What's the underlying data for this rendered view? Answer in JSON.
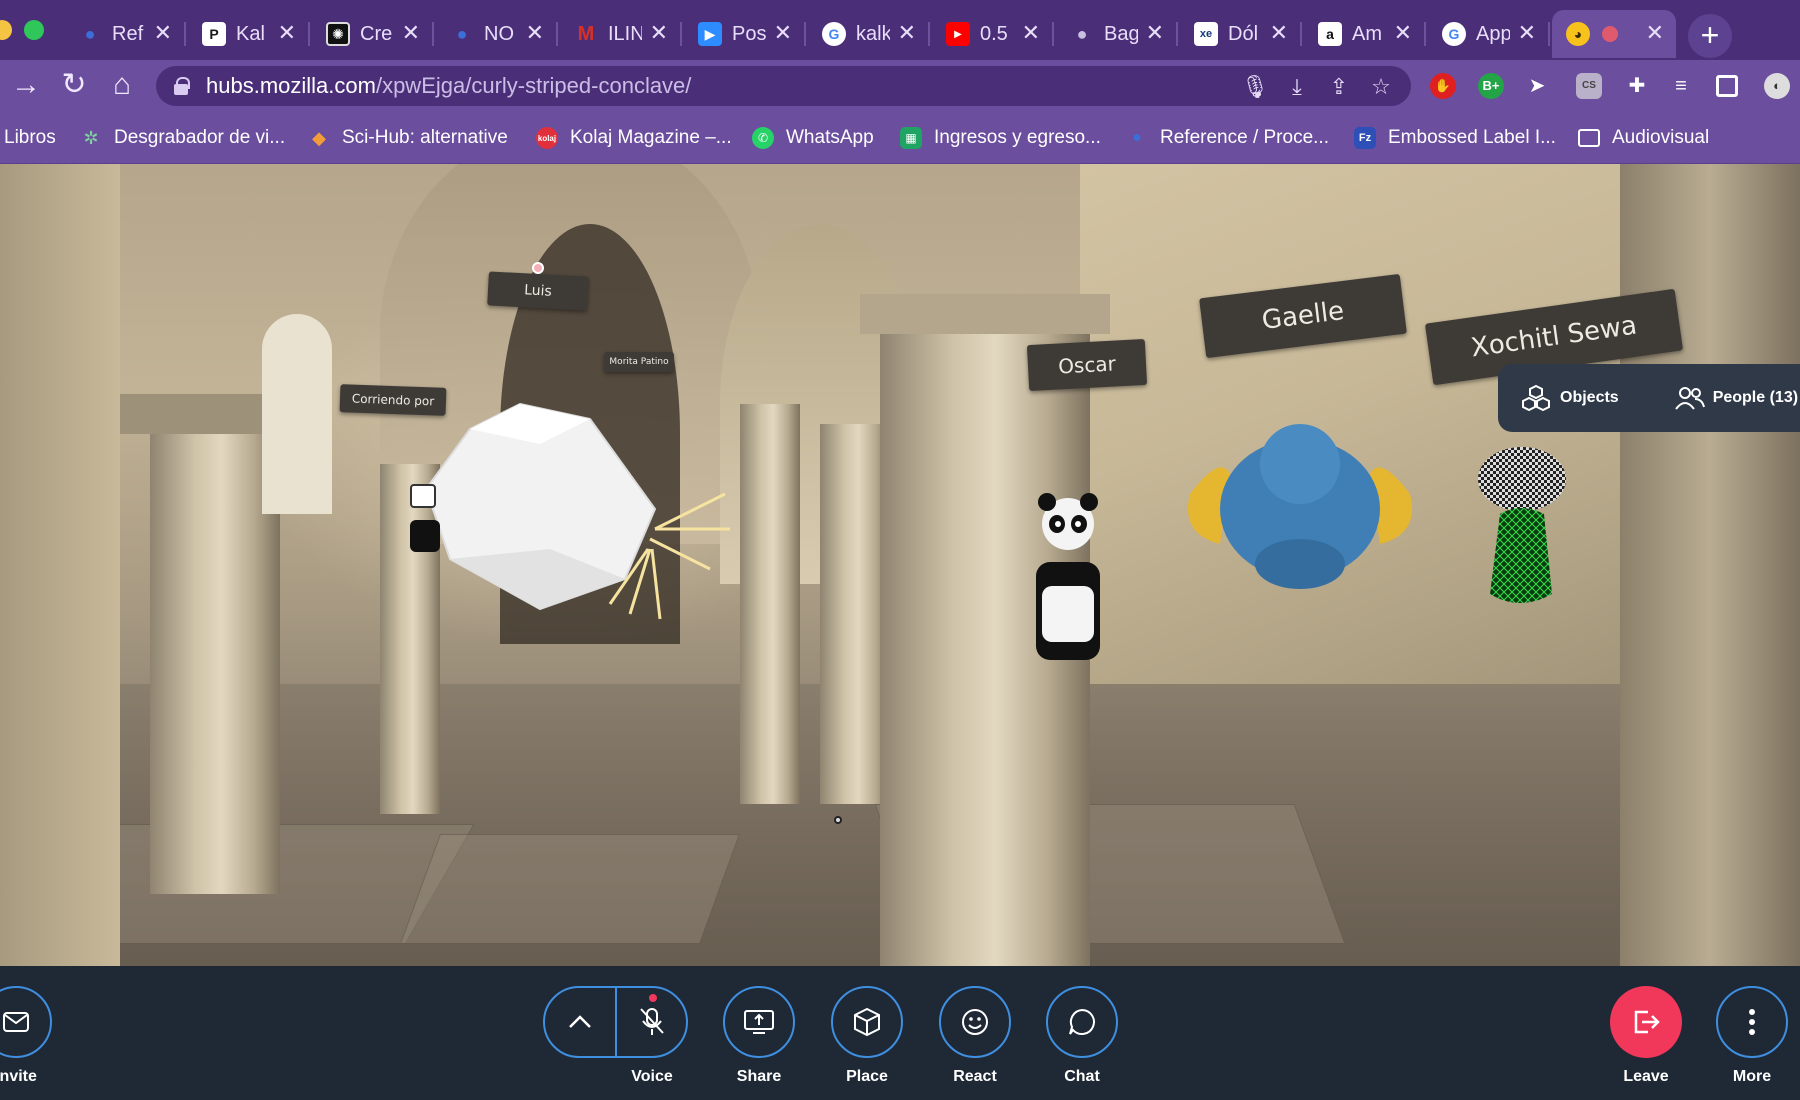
{
  "browser": {
    "tabs": [
      {
        "title": "Ref",
        "favicon": "blue-dots-icon",
        "color": "#3b6fd8"
      },
      {
        "title": "Kal",
        "favicon": "p-letter-icon",
        "color": "#1b1b1b"
      },
      {
        "title": "Cre",
        "favicon": "pattern-icon",
        "color": "#111111"
      },
      {
        "title": "NO",
        "favicon": "blue-dots-icon",
        "color": "#3b6fd8"
      },
      {
        "title": "ILIN",
        "favicon": "gmail-icon",
        "color": "#d93025"
      },
      {
        "title": "Pos",
        "favicon": "zoom-camera-icon",
        "color": "#2d8cff"
      },
      {
        "title": "kalk",
        "favicon": "google-g-icon",
        "color": "#ffffff"
      },
      {
        "title": "0.5",
        "favicon": "youtube-icon",
        "color": "#ff0000"
      },
      {
        "title": "Bag",
        "favicon": "apple-icon",
        "color": "#8a7fa0"
      },
      {
        "title": "Dól",
        "favicon": "xe-icon",
        "color": "#1a3a7a"
      },
      {
        "title": "Am",
        "favicon": "amazon-a-icon",
        "color": "#ffffff"
      },
      {
        "title": "App",
        "favicon": "google-g-icon",
        "color": "#ffffff"
      },
      {
        "title": "",
        "favicon": "hubs-duck-icon",
        "color": "#f7c21b",
        "active": true
      }
    ],
    "url_host": "hubs.mozilla.com",
    "url_path": "/xpwEjga/curly-striped-conclave/",
    "bookmarks": [
      {
        "label": "Libros",
        "icon": "none"
      },
      {
        "label": "Desgrabador de vi...",
        "icon": "gear-wheel-icon"
      },
      {
        "label": "Sci-Hub: alternative",
        "icon": "raven-icon"
      },
      {
        "label": "Kolaj Magazine –...",
        "icon": "kolaj-icon"
      },
      {
        "label": "WhatsApp",
        "icon": "whatsapp-icon"
      },
      {
        "label": "Ingresos y egreso...",
        "icon": "sheets-icon"
      },
      {
        "label": "Reference / Proce...",
        "icon": "blue-dots-icon"
      },
      {
        "label": "Embossed Label I...",
        "icon": "fz-icon"
      },
      {
        "label": "Audiovisual",
        "icon": "folder-icon"
      }
    ],
    "colors": {
      "frame": "#4a2f78",
      "toolbar": "#6b4e9e"
    }
  },
  "scene": {
    "name_tags": [
      "Luis",
      "Morita Patino",
      "Corriendo por",
      "Oscar",
      "Gaelle",
      "Xochitl Sewa"
    ],
    "hud": {
      "objects_label": "Objects",
      "people_label": "People (13)"
    }
  },
  "bottom_bar": {
    "invite_label": "Invite",
    "voice_label": "Voice",
    "share_label": "Share",
    "place_label": "Place",
    "react_label": "React",
    "chat_label": "Chat",
    "leave_label": "Leave",
    "more_label": "More",
    "colors": {
      "ring": "#3f8fe0",
      "leave": "#f2385a",
      "bar": "#1f2835"
    }
  }
}
